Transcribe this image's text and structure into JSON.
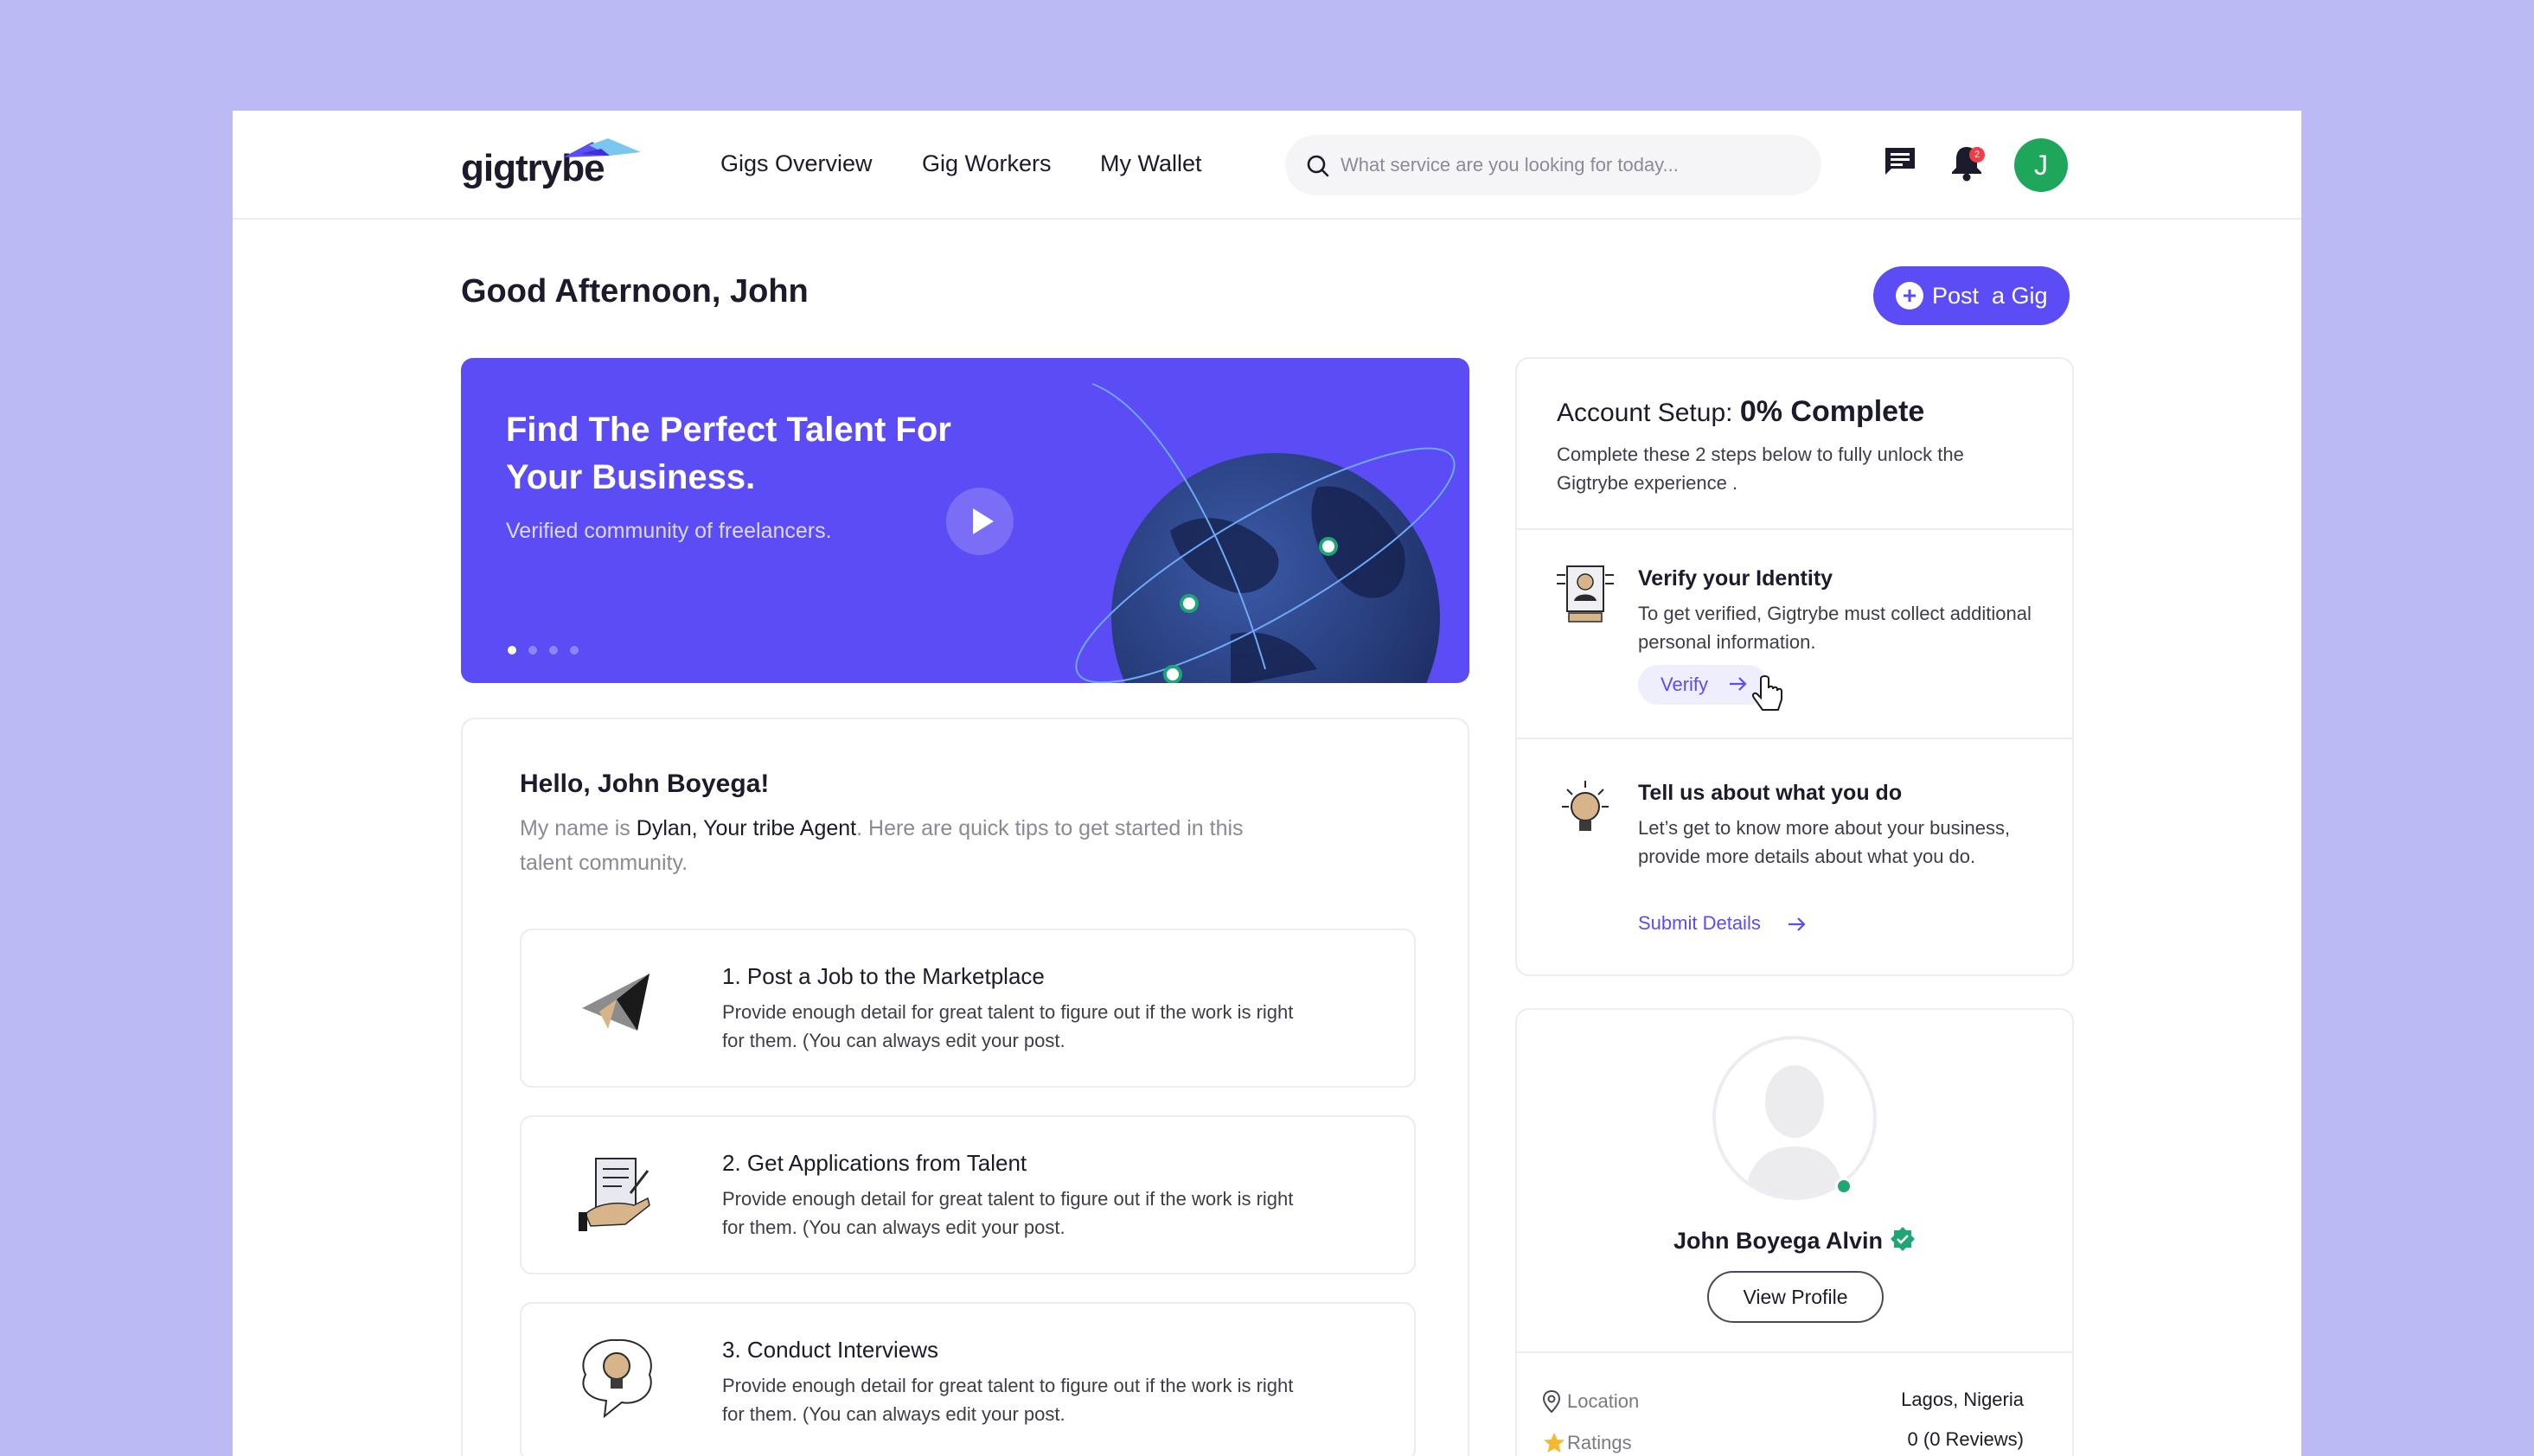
{
  "app": {
    "logo_text": "gigtrybe"
  },
  "nav": {
    "items": [
      "Gigs Overview",
      "Gig Workers",
      "My Wallet"
    ]
  },
  "search": {
    "placeholder": "What service are you looking for today..."
  },
  "header": {
    "notification_count": "2",
    "avatar_initial": "J"
  },
  "greeting": "Good Afternoon, John",
  "post_gig": {
    "label": "Post  a Gig"
  },
  "banner": {
    "title": "Find The Perfect Talent For Your Business.",
    "subtitle": "Verified community of freelancers.",
    "slides": 4,
    "active_slide": 1
  },
  "tips": {
    "hello": "Hello, John Boyega!",
    "intro_prefix": "My name is ",
    "agent": "Dylan, Your tribe Agent",
    "intro_suffix": ". Here are quick tips to get started in this talent community.",
    "items": [
      {
        "title": "1. Post a Job to the Marketplace",
        "desc": "Provide enough detail for great talent to figure out if the work is right for them. (You can always edit your post."
      },
      {
        "title": "2. Get Applications from Talent",
        "desc": "Provide enough detail for great talent to figure out if the work is right for them. (You can always edit your post."
      },
      {
        "title": "3. Conduct Interviews",
        "desc": "Provide enough detail for great talent to figure out if the work is right for them. (You can always edit your post."
      }
    ]
  },
  "setup": {
    "label": "Account Setup: ",
    "percent": "0% Complete",
    "subtitle": "Complete these 2 steps below to fully unlock the Gigtrybe experience .",
    "steps": [
      {
        "title": "Verify your Identity",
        "desc": "To get verified, Gigtrybe must collect additional personal information.",
        "action": "Verify"
      },
      {
        "title": "Tell us about what you do",
        "desc": "Let’s get to know more about your business, provide more details about what you do.",
        "action": "Submit Details"
      }
    ]
  },
  "profile": {
    "name": "John Boyega Alvin",
    "view_label": "View Profile",
    "location_label": "Location",
    "location_value": "Lagos, Nigeria",
    "ratings_label": "Ratings",
    "ratings_value": "0 (0 Reviews)"
  },
  "colors": {
    "accent": "#5b4cf5",
    "background": "#bcbaf5",
    "avatar": "#1ea75a",
    "online": "#1ea774"
  }
}
